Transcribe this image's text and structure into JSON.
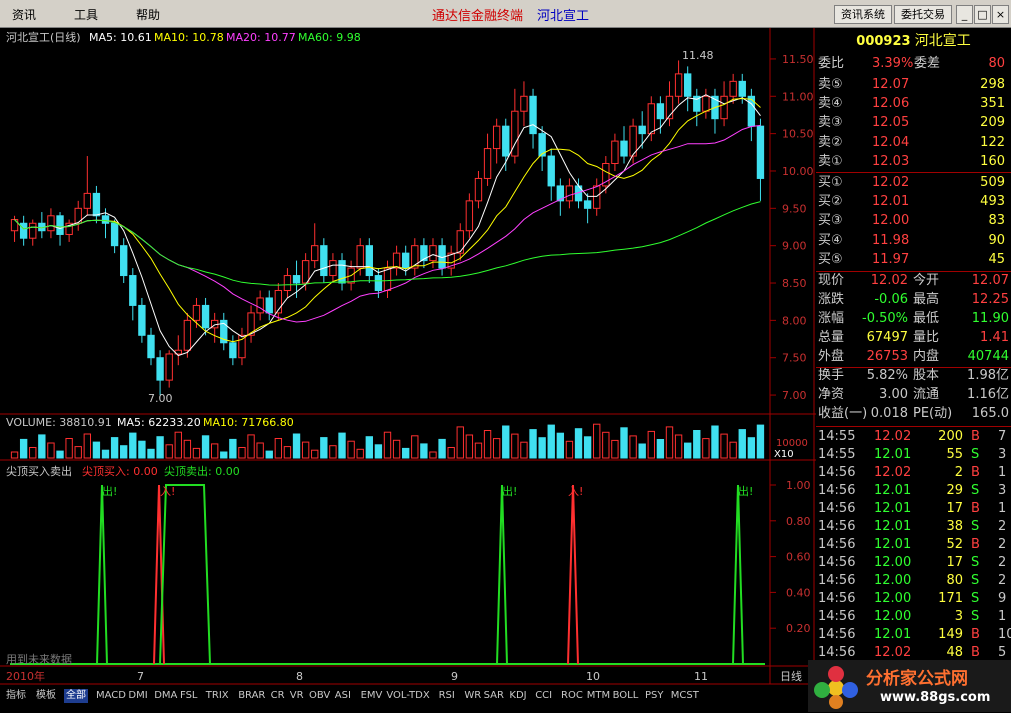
{
  "menubar": {
    "items": [
      "资讯",
      "工具",
      "帮助"
    ],
    "title_left": "通达信金融终端",
    "title_right": "河北宣工",
    "btn_info": "资讯系统",
    "btn_trade": "委托交易"
  },
  "chart_header": {
    "name": "河北宣工(日线)",
    "ma5": "MA5: 10.61",
    "ma10": "MA10: 10.78",
    "ma20": "MA20: 10.77",
    "ma60": "MA60: 9.98"
  },
  "price_axis": [
    "11.50",
    "11.00",
    "10.50",
    "10.00",
    "9.50",
    "9.00",
    "8.50",
    "8.00",
    "7.50",
    "7.00"
  ],
  "annotations": {
    "high": "11.48",
    "low": "7.00"
  },
  "volume_header": {
    "label": "VOLUME: 38810.91",
    "ma5": "MA5: 62233.20",
    "ma10": "MA10: 71766.80"
  },
  "volume_axis": {
    "label": "10000",
    "unit": "X10"
  },
  "indicator_header": {
    "label": "尖顶买入卖出",
    "buy": "尖顶买入: 0.00",
    "sell": "尖顶卖出: 0.00"
  },
  "indicator_axis": [
    "1.00",
    "0.80",
    "0.60",
    "0.40",
    "0.20"
  ],
  "indicator_marks": [
    {
      "text": "出!",
      "color": "#22dd22"
    },
    {
      "text": "入!",
      "color": "#ff3030"
    },
    {
      "text": "出!",
      "color": "#22dd22"
    },
    {
      "text": "入!",
      "color": "#ff3030"
    },
    {
      "text": "出!",
      "color": "#22dd22"
    }
  ],
  "footnote": "用到未来数据",
  "x_axis": [
    "2010年",
    "7",
    "8",
    "9",
    "10",
    "11"
  ],
  "period_label": "日线",
  "quote": {
    "code": "000923",
    "name": "河北宣工",
    "weibi_label": "委比",
    "weibi_value": "3.39%",
    "weicha_label": "委差",
    "weicha_value": "80",
    "sells": [
      {
        "label": "卖⑤",
        "price": "12.07",
        "vol": "298"
      },
      {
        "label": "卖④",
        "price": "12.06",
        "vol": "351"
      },
      {
        "label": "卖③",
        "price": "12.05",
        "vol": "209"
      },
      {
        "label": "卖②",
        "price": "12.04",
        "vol": "122"
      },
      {
        "label": "卖①",
        "price": "12.03",
        "vol": "160"
      }
    ],
    "buys": [
      {
        "label": "买①",
        "price": "12.02",
        "vol": "509"
      },
      {
        "label": "买②",
        "price": "12.01",
        "vol": "493"
      },
      {
        "label": "买③",
        "price": "12.00",
        "vol": "83"
      },
      {
        "label": "买④",
        "price": "11.98",
        "vol": "90"
      },
      {
        "label": "买⑤",
        "price": "11.97",
        "vol": "45"
      }
    ],
    "stats": [
      [
        "现价",
        "12.02",
        "今开",
        "12.07"
      ],
      [
        "涨跌",
        "-0.06",
        "最高",
        "12.25"
      ],
      [
        "涨幅",
        "-0.50%",
        "最低",
        "11.90"
      ],
      [
        "总量",
        "67497",
        "量比",
        "1.41"
      ],
      [
        "外盘",
        "26753",
        "内盘",
        "40744"
      ],
      [
        "换手",
        "5.82%",
        "股本",
        "1.98亿"
      ],
      [
        "净资",
        "3.00",
        "流通",
        "1.16亿"
      ],
      [
        "收益(一)",
        "0.018",
        "PE(动)",
        "165.0"
      ]
    ],
    "ticks": [
      [
        "14:55",
        "12.02",
        "200",
        "B",
        "7"
      ],
      [
        "14:55",
        "12.01",
        "55",
        "S",
        "3"
      ],
      [
        "14:56",
        "12.02",
        "2",
        "B",
        "1"
      ],
      [
        "14:56",
        "12.01",
        "29",
        "S",
        "3"
      ],
      [
        "14:56",
        "12.01",
        "17",
        "B",
        "1"
      ],
      [
        "14:56",
        "12.01",
        "38",
        "S",
        "2"
      ],
      [
        "14:56",
        "12.01",
        "52",
        "B",
        "2"
      ],
      [
        "14:56",
        "12.00",
        "17",
        "S",
        "2"
      ],
      [
        "14:56",
        "12.00",
        "80",
        "S",
        "2"
      ],
      [
        "14:56",
        "12.00",
        "171",
        "S",
        "9"
      ],
      [
        "14:56",
        "12.00",
        "3",
        "S",
        "1"
      ],
      [
        "14:56",
        "12.01",
        "149",
        "B",
        "10"
      ],
      [
        "14:56",
        "12.02",
        "48",
        "B",
        "5"
      ]
    ]
  },
  "tabs": [
    "指标",
    "模板",
    "全部",
    "MACD",
    "DMI",
    "DMA",
    "FSL",
    "TRIX",
    "BRAR",
    "CR",
    "VR",
    "OBV",
    "ASI",
    "EMV",
    "VOL-TDX",
    "RSI",
    "WR",
    "SAR",
    "KDJ",
    "CCI",
    "ROC",
    "MTM",
    "BOLL",
    "PSY",
    "MCST"
  ],
  "watermark": {
    "title": "分析家公式网",
    "url": "www.88gs.com"
  },
  "chart_data": {
    "type": "candlestick",
    "title": "河北宣工(日线)",
    "ylim": [
      6.8,
      11.7
    ],
    "candles": [
      [
        9.2,
        9.35,
        9.05,
        9.4
      ],
      [
        9.3,
        9.1,
        9.0,
        9.4
      ],
      [
        9.1,
        9.3,
        9.0,
        9.35
      ],
      [
        9.3,
        9.2,
        9.1,
        9.45
      ],
      [
        9.2,
        9.4,
        9.1,
        9.5
      ],
      [
        9.4,
        9.15,
        9.0,
        9.45
      ],
      [
        9.15,
        9.3,
        9.05,
        9.35
      ],
      [
        9.3,
        9.5,
        9.2,
        9.6
      ],
      [
        9.5,
        9.7,
        9.4,
        10.2
      ],
      [
        9.7,
        9.4,
        9.3,
        9.8
      ],
      [
        9.4,
        9.3,
        9.1,
        9.5
      ],
      [
        9.3,
        9.0,
        8.9,
        9.35
      ],
      [
        9.0,
        8.6,
        8.5,
        9.1
      ],
      [
        8.6,
        8.2,
        8.0,
        8.7
      ],
      [
        8.2,
        7.8,
        7.7,
        8.3
      ],
      [
        7.8,
        7.5,
        7.4,
        7.9
      ],
      [
        7.5,
        7.2,
        7.0,
        7.6
      ],
      [
        7.2,
        7.55,
        7.1,
        7.6
      ],
      [
        7.55,
        7.6,
        7.4,
        7.8
      ],
      [
        7.6,
        8.0,
        7.5,
        8.1
      ],
      [
        8.0,
        8.2,
        7.9,
        8.3
      ],
      [
        8.2,
        7.9,
        7.8,
        8.3
      ],
      [
        7.9,
        8.0,
        7.7,
        8.1
      ],
      [
        8.0,
        7.7,
        7.6,
        8.1
      ],
      [
        7.7,
        7.5,
        7.4,
        7.8
      ],
      [
        7.5,
        7.8,
        7.4,
        7.9
      ],
      [
        7.8,
        8.1,
        7.7,
        8.2
      ],
      [
        8.1,
        8.3,
        8.0,
        8.4
      ],
      [
        8.3,
        8.1,
        8.0,
        8.4
      ],
      [
        8.1,
        8.4,
        8.0,
        8.5
      ],
      [
        8.4,
        8.6,
        8.3,
        8.7
      ],
      [
        8.6,
        8.5,
        8.3,
        8.8
      ],
      [
        8.5,
        8.8,
        8.4,
        8.9
      ],
      [
        8.8,
        9.0,
        8.7,
        9.3
      ],
      [
        9.0,
        8.6,
        8.5,
        9.1
      ],
      [
        8.6,
        8.8,
        8.5,
        8.9
      ],
      [
        8.8,
        8.5,
        8.4,
        8.9
      ],
      [
        8.5,
        8.7,
        8.4,
        8.8
      ],
      [
        8.7,
        9.0,
        8.6,
        9.1
      ],
      [
        9.0,
        8.6,
        8.5,
        9.1
      ],
      [
        8.6,
        8.4,
        8.3,
        8.7
      ],
      [
        8.4,
        8.7,
        8.3,
        8.8
      ],
      [
        8.7,
        8.9,
        8.6,
        9.0
      ],
      [
        8.9,
        8.7,
        8.6,
        9.0
      ],
      [
        8.7,
        9.0,
        8.6,
        9.1
      ],
      [
        9.0,
        8.8,
        8.7,
        9.1
      ],
      [
        8.8,
        9.0,
        8.7,
        9.1
      ],
      [
        9.0,
        8.7,
        8.6,
        9.1
      ],
      [
        8.7,
        8.9,
        8.6,
        9.0
      ],
      [
        8.9,
        9.2,
        8.8,
        9.3
      ],
      [
        9.2,
        9.6,
        9.1,
        9.7
      ],
      [
        9.6,
        9.9,
        9.5,
        10.0
      ],
      [
        9.9,
        10.3,
        9.8,
        10.5
      ],
      [
        10.3,
        10.6,
        10.1,
        10.7
      ],
      [
        10.6,
        10.2,
        10.0,
        10.7
      ],
      [
        10.2,
        10.8,
        10.1,
        11.1
      ],
      [
        10.8,
        11.0,
        10.6,
        11.2
      ],
      [
        11.0,
        10.5,
        10.3,
        11.1
      ],
      [
        10.5,
        10.2,
        10.0,
        10.6
      ],
      [
        10.2,
        9.8,
        9.6,
        10.3
      ],
      [
        9.8,
        9.6,
        9.4,
        9.9
      ],
      [
        9.6,
        9.8,
        9.5,
        9.9
      ],
      [
        9.8,
        9.6,
        9.5,
        9.9
      ],
      [
        9.6,
        9.5,
        9.3,
        9.7
      ],
      [
        9.5,
        9.8,
        9.4,
        9.9
      ],
      [
        9.8,
        10.1,
        9.7,
        10.2
      ],
      [
        10.1,
        10.4,
        10.0,
        10.5
      ],
      [
        10.4,
        10.2,
        10.1,
        10.6
      ],
      [
        10.2,
        10.6,
        10.1,
        10.7
      ],
      [
        10.6,
        10.5,
        10.3,
        10.8
      ],
      [
        10.5,
        10.9,
        10.4,
        11.0
      ],
      [
        10.9,
        10.7,
        10.5,
        11.0
      ],
      [
        10.7,
        11.0,
        10.6,
        11.2
      ],
      [
        11.0,
        11.3,
        10.9,
        11.48
      ],
      [
        11.3,
        11.0,
        10.8,
        11.4
      ],
      [
        11.0,
        10.8,
        10.6,
        11.1
      ],
      [
        10.8,
        11.0,
        10.7,
        11.1
      ],
      [
        11.0,
        10.7,
        10.5,
        11.1
      ],
      [
        10.7,
        11.0,
        10.6,
        11.2
      ],
      [
        11.0,
        11.2,
        10.9,
        11.3
      ],
      [
        11.2,
        11.0,
        10.9,
        11.3
      ],
      [
        11.0,
        10.6,
        10.4,
        11.1
      ],
      [
        10.6,
        9.9,
        9.6,
        10.7
      ]
    ]
  }
}
